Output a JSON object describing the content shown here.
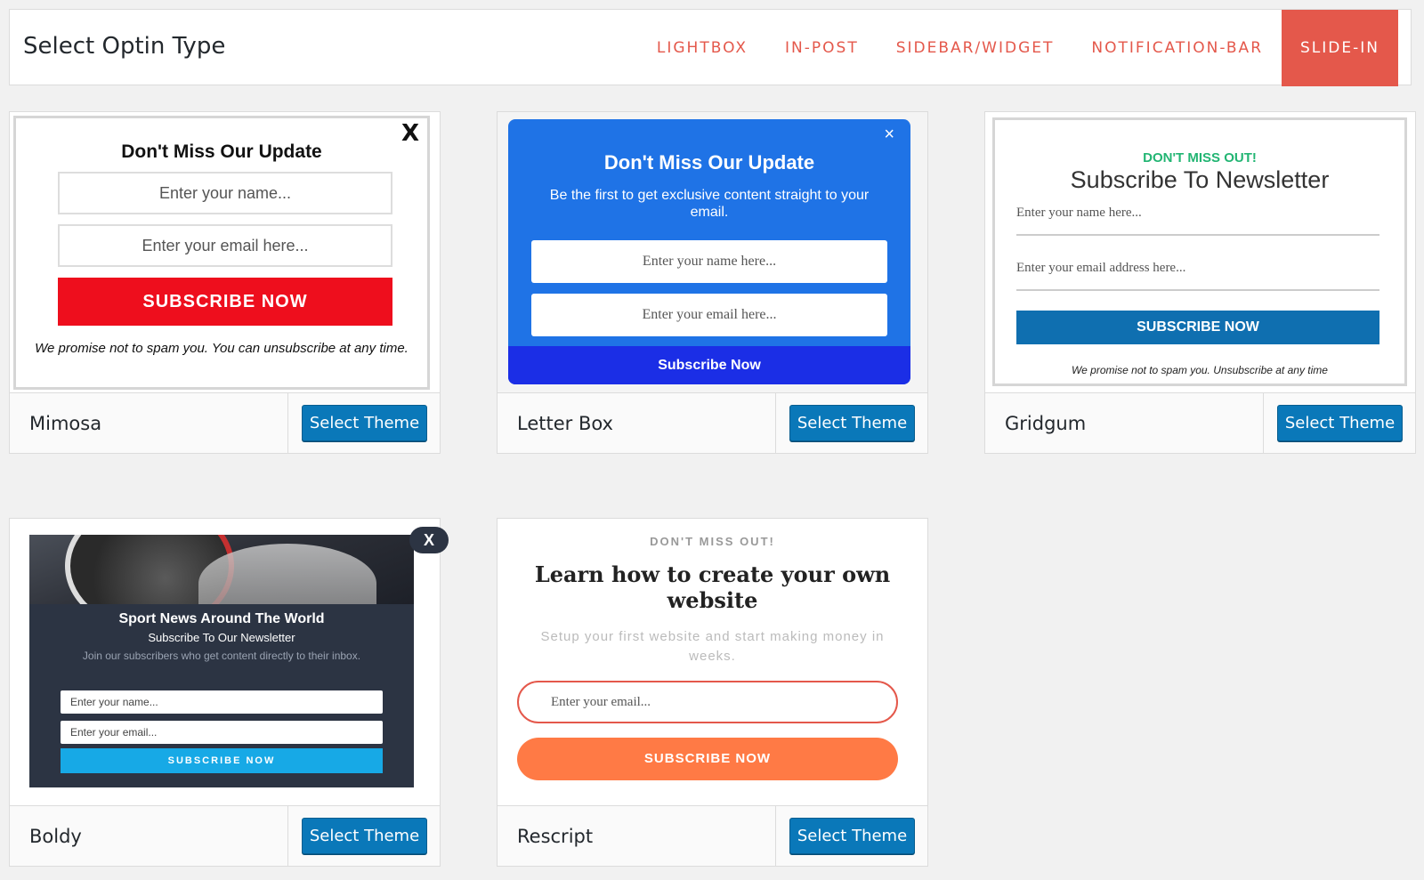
{
  "header": {
    "title": "Select Optin Type",
    "tabs": [
      {
        "label": "LIGHTBOX",
        "active": false
      },
      {
        "label": "IN-POST",
        "active": false
      },
      {
        "label": "SIDEBAR/WIDGET",
        "active": false
      },
      {
        "label": "NOTIFICATION-BAR",
        "active": false
      },
      {
        "label": "SLIDE-IN",
        "active": true
      }
    ]
  },
  "colors": {
    "accent": "#e4584b",
    "primary_button": "#0a78b9",
    "page_background": "#f1f1f1"
  },
  "select_button_label": "Select Theme",
  "themes": [
    {
      "name": "Mimosa",
      "preview": {
        "close": "X",
        "headline": "Don't Miss Our Update",
        "name_placeholder": "Enter your name...",
        "email_placeholder": "Enter your email here...",
        "button": "SUBSCRIBE NOW",
        "note": "We promise not to spam you. You can unsubscribe at any time."
      }
    },
    {
      "name": "Letter Box",
      "preview": {
        "close": "×",
        "headline": "Don't Miss Our Update",
        "subtext": "Be the first to get exclusive content straight to your email.",
        "name_placeholder": "Enter your name here...",
        "email_placeholder": "Enter your email here...",
        "button": "Subscribe Now"
      }
    },
    {
      "name": "Gridgum",
      "preview": {
        "kicker": "DON'T MISS OUT!",
        "headline": "Subscribe To Newsletter",
        "name_placeholder": "Enter your name here...",
        "email_placeholder": "Enter your email address here...",
        "button": "SUBSCRIBE NOW",
        "note": "We promise not to spam you. Unsubscribe at any time"
      }
    },
    {
      "name": "Boldy",
      "preview": {
        "close": "X",
        "headline": "Sport News Around The World",
        "subheadline": "Subscribe To Our Newsletter",
        "description": "Join our subscribers who get content directly to their inbox.",
        "name_placeholder": "Enter your name...",
        "email_placeholder": "Enter your email...",
        "button": "SUBSCRIBE NOW"
      }
    },
    {
      "name": "Rescript",
      "preview": {
        "kicker": "DON'T MISS OUT!",
        "headline": "Learn how to create your own website",
        "description": "Setup your first website and start making money in weeks.",
        "email_placeholder": "Enter your email...",
        "button": "SUBSCRIBE NOW"
      }
    }
  ]
}
